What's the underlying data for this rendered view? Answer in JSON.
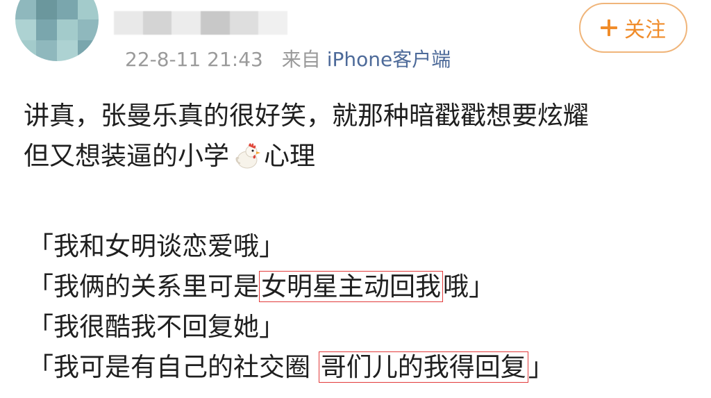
{
  "header": {
    "meta_date": "22-8-11 21:43",
    "source_label": "来自",
    "source_app": "iPhone客户端",
    "follow_button_label": "关注",
    "follow_icon": "plus-icon",
    "accent_color": "#f08c2a",
    "username_blurred": true,
    "avatar_pixelated": true
  },
  "post": {
    "line1": "讲真，张曼乐真的很好笑，就那种暗戳戳想要炫耀",
    "line2_before_emoji": "但又想装逼的小学",
    "emoji": "chicken-emoji-icon",
    "line2_after_emoji": "心理",
    "quotes": [
      {
        "before": "「我和女明谈恋爱哦」",
        "highlight": "",
        "after": ""
      },
      {
        "before": "「我俩的关系里可是",
        "highlight": "女明星主动回我",
        "after": "哦」"
      },
      {
        "before": "「我很酷我不回复她」",
        "highlight": "",
        "after": ""
      },
      {
        "before": "「我可是有自己的社交圈 ",
        "highlight": "哥们儿的我得回复",
        "after": "」"
      }
    ],
    "highlight_color": "#e23a3a"
  }
}
